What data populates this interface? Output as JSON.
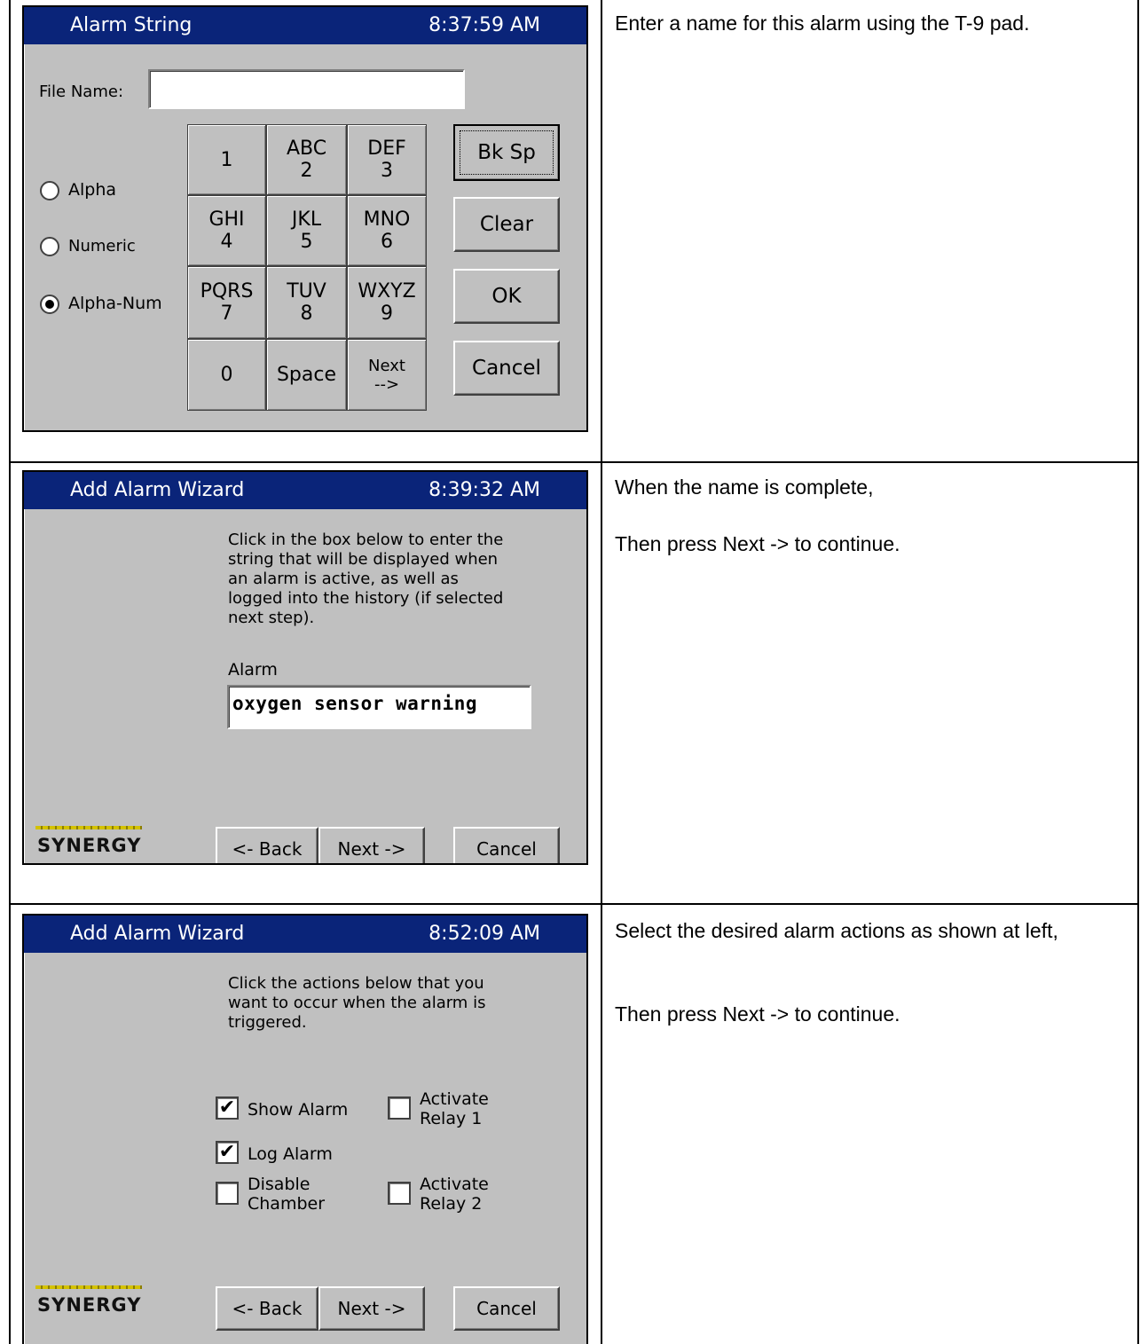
{
  "panels": [
    {
      "title": "Alarm String",
      "time": "8:37:59 AM",
      "file_name_label": "File Name:",
      "file_name_value": "",
      "radios": [
        {
          "label": "Alpha",
          "selected": false
        },
        {
          "label": "Numeric",
          "selected": false
        },
        {
          "label": "Alpha-Num",
          "selected": true
        }
      ],
      "keys": [
        {
          "top": "",
          "bottom": "1"
        },
        {
          "top": "ABC",
          "bottom": "2"
        },
        {
          "top": "DEF",
          "bottom": "3"
        },
        {
          "top": "GHI",
          "bottom": "4"
        },
        {
          "top": "JKL",
          "bottom": "5"
        },
        {
          "top": "MNO",
          "bottom": "6"
        },
        {
          "top": "PQRS",
          "bottom": "7"
        },
        {
          "top": "TUV",
          "bottom": "8"
        },
        {
          "top": "WXYZ",
          "bottom": "9"
        },
        {
          "top": "",
          "bottom": "0"
        },
        {
          "top": "",
          "bottom": "Space"
        },
        {
          "top": "Next",
          "bottom": "-->"
        }
      ],
      "side_buttons": [
        "Bk Sp",
        "Clear",
        "OK",
        "Cancel"
      ],
      "description": "Enter a name for this alarm using the T-9 pad."
    },
    {
      "title": "Add Alarm Wizard",
      "time": "8:39:32 AM",
      "instructions": "Click in the box below to enter the string that will be displayed when an alarm is active, as well as logged into the history (if selected next step).",
      "alarm_label": "Alarm",
      "alarm_value": "oxygen sensor warning",
      "logo_text": "SYNERGY",
      "back_label": "<- Back",
      "next_label": "Next ->",
      "cancel_label": "Cancel",
      "description_1": "When the name is complete,",
      "description_2": "Then press Next -> to continue."
    },
    {
      "title": "Add Alarm Wizard",
      "time": "8:52:09 AM",
      "instructions": "Click the actions below that you want to occur when the alarm is triggered.",
      "checkboxes": [
        {
          "label": "Show Alarm",
          "checked": true
        },
        {
          "label": "Activate Relay 1",
          "checked": false
        },
        {
          "label": "Log Alarm",
          "checked": true
        },
        {
          "label": "Disable Chamber",
          "checked": false
        },
        {
          "label": "Activate Relay 2",
          "checked": false
        }
      ],
      "logo_text": "SYNERGY",
      "back_label": "<- Back",
      "next_label": "Next ->",
      "cancel_label": "Cancel",
      "description_1": "Select the desired alarm actions as shown at left,",
      "description_2": "Then press Next -> to continue."
    }
  ],
  "colors": {
    "titlebar": "#0a2479",
    "window_bg": "#c0c0c0",
    "logo_stripe": "#d4c200"
  },
  "icons": {
    "check": "check-mark-icon",
    "radio": "radio-dot-icon"
  }
}
